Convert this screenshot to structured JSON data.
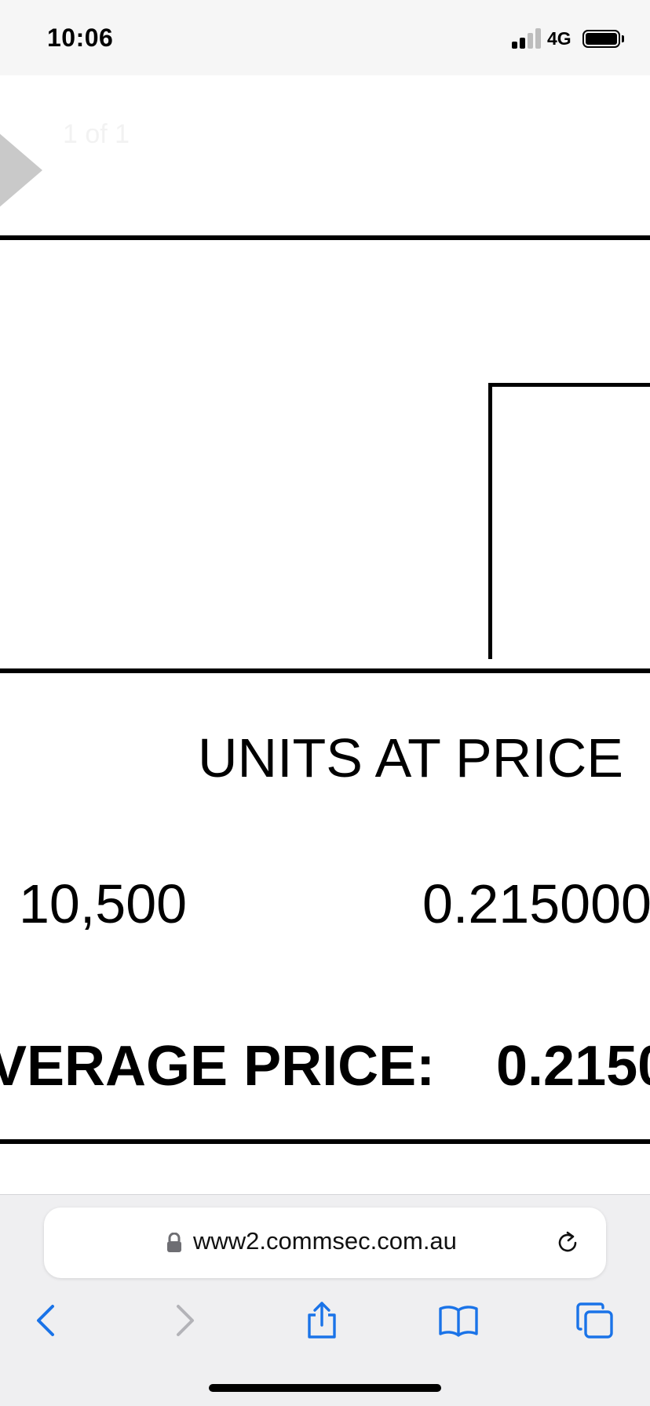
{
  "status_bar": {
    "time": "10:06",
    "network": "4G"
  },
  "document": {
    "page_counter": "1 of 1",
    "units_heading": "UNITS AT PRICE",
    "quantity": "10,500",
    "price": "0.215000",
    "average_price_label": "VERAGE PRICE:",
    "average_price_value": "0.2150"
  },
  "browser": {
    "url": "www2.commsec.com.au",
    "icons": [
      "lock-icon",
      "reload-icon",
      "back-icon",
      "forward-icon",
      "share-icon",
      "bookmarks-icon",
      "tabs-icon"
    ]
  },
  "colors": {
    "accent": "#1a73e8",
    "disabled": "#b3b3b8",
    "toolbar_bg": "#efeff1",
    "status_bg": "#f6f6f6"
  }
}
